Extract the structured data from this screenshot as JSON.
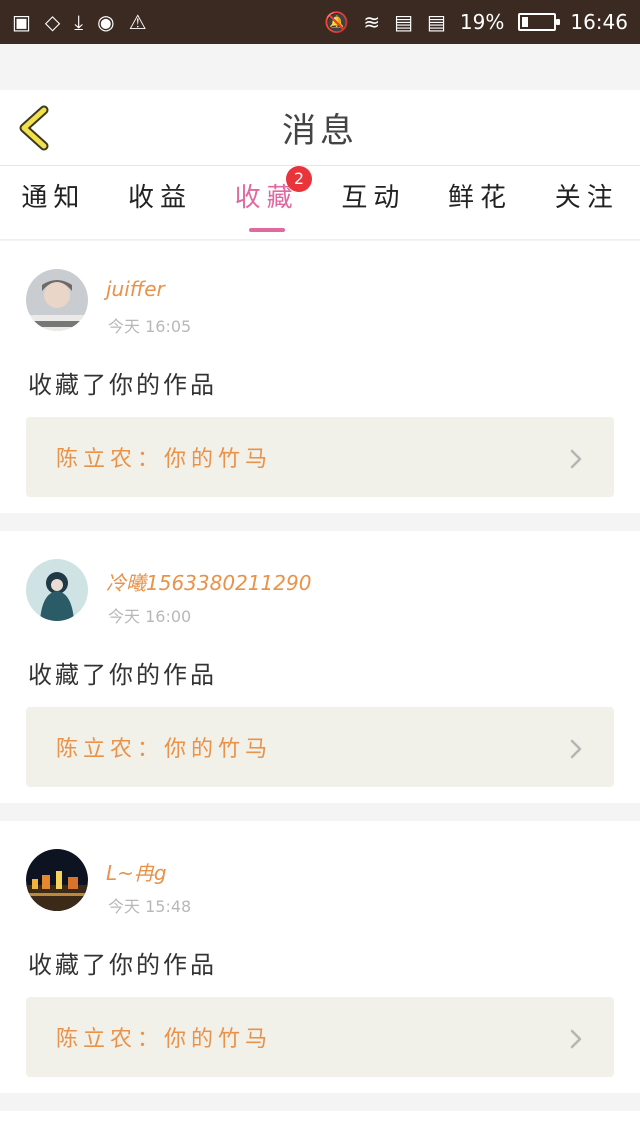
{
  "status_bar": {
    "battery": "19%",
    "time": "16:46",
    "battery_level": 0.19
  },
  "header": {
    "title": "消息"
  },
  "tabs": [
    {
      "label": "通知"
    },
    {
      "label": "收益"
    },
    {
      "label": "收藏",
      "active": true,
      "badge": "2"
    },
    {
      "label": "互动"
    },
    {
      "label": "鲜花"
    },
    {
      "label": "关注"
    }
  ],
  "messages": [
    {
      "name": "juiffer",
      "time": "今天 16:05",
      "action": "收藏了你的作品",
      "work": "陈立农：你的竹马"
    },
    {
      "name": "冷曦1563380211290",
      "time": "今天 16:00",
      "action": "收藏了你的作品",
      "work": "陈立农：你的竹马"
    },
    {
      "name": "L~冉g",
      "time": "今天 15:48",
      "action": "收藏了你的作品",
      "work": "陈立农：你的竹马"
    }
  ],
  "colors": {
    "accent": "#e06aa0",
    "name": "#e8924a",
    "badge": "#e8343a",
    "status_bar": "#3a2a22"
  }
}
